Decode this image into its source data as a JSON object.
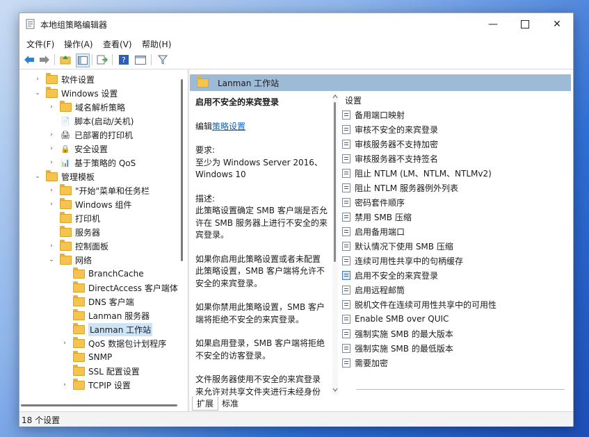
{
  "window": {
    "title": "本地组策略编辑器"
  },
  "menu": [
    "文件(F)",
    "操作(A)",
    "查看(V)",
    "帮助(H)"
  ],
  "tree": [
    {
      "label": "软件设置",
      "depth": 1,
      "arrow": "›",
      "icon": "folder"
    },
    {
      "label": "Windows 设置",
      "depth": 1,
      "arrow": "⌄",
      "icon": "folder"
    },
    {
      "label": "域名解析策略",
      "depth": 2,
      "arrow": "›",
      "icon": "folder"
    },
    {
      "label": "脚本(启动/关机)",
      "depth": 2,
      "arrow": "",
      "icon": "script-icon"
    },
    {
      "label": "已部署的打印机",
      "depth": 2,
      "arrow": "›",
      "icon": "printer-icon"
    },
    {
      "label": "安全设置",
      "depth": 2,
      "arrow": "›",
      "icon": "security-icon"
    },
    {
      "label": "基于策略的 QoS",
      "depth": 2,
      "arrow": "›",
      "icon": "chart-icon"
    },
    {
      "label": "管理模板",
      "depth": 1,
      "arrow": "⌄",
      "icon": "folder"
    },
    {
      "label": "\"开始\"菜单和任务栏",
      "depth": 2,
      "arrow": "›",
      "icon": "folder"
    },
    {
      "label": "Windows 组件",
      "depth": 2,
      "arrow": "›",
      "icon": "folder"
    },
    {
      "label": "打印机",
      "depth": 2,
      "arrow": "",
      "icon": "folder"
    },
    {
      "label": "服务器",
      "depth": 2,
      "arrow": "",
      "icon": "folder"
    },
    {
      "label": "控制面板",
      "depth": 2,
      "arrow": "›",
      "icon": "folder"
    },
    {
      "label": "网络",
      "depth": 2,
      "arrow": "⌄",
      "icon": "folder"
    },
    {
      "label": "BranchCache",
      "depth": 3,
      "arrow": "",
      "icon": "folder"
    },
    {
      "label": "DirectAccess 客户端体",
      "depth": 3,
      "arrow": "",
      "icon": "folder"
    },
    {
      "label": "DNS 客户端",
      "depth": 3,
      "arrow": "",
      "icon": "folder"
    },
    {
      "label": "Lanman 服务器",
      "depth": 3,
      "arrow": "",
      "icon": "folder"
    },
    {
      "label": "Lanman 工作站",
      "depth": 3,
      "arrow": "",
      "icon": "folder",
      "selected": true
    },
    {
      "label": "QoS 数据包计划程序",
      "depth": 3,
      "arrow": "›",
      "icon": "folder"
    },
    {
      "label": "SNMP",
      "depth": 3,
      "arrow": "",
      "icon": "folder"
    },
    {
      "label": "SSL 配置设置",
      "depth": 3,
      "arrow": "",
      "icon": "folder"
    },
    {
      "label": "TCPIP 设置",
      "depth": 3,
      "arrow": "›",
      "icon": "folder"
    }
  ],
  "header": {
    "title": "Lanman 工作站"
  },
  "description": {
    "title": "启用不安全的来宾登录",
    "edit_prefix": "编辑",
    "edit_link": "策略设置",
    "requirements": "要求:\n至少为 Windows Server 2016、Windows 10",
    "desc_label": "描述:",
    "p1": "此策略设置确定 SMB 客户端是否允许在 SMB 服务器上进行不安全的来宾登录。",
    "p2": "如果你启用此策略设置或者未配置此策略设置，SMB 客户端将允许不安全的来宾登录。",
    "p3": "如果你禁用此策略设置，SMB 客户端将拒绝不安全的来宾登录。",
    "p4": "如果启用登录，SMB 客户端将拒绝不安全的访客登录。",
    "p5": "文件服务器使用不安全的来宾登录来允许对共享文件夹进行未经身份"
  },
  "settings": {
    "header": "设置",
    "items": [
      "备用端口映射",
      "审核不安全的来宾登录",
      "审核服务器不支持加密",
      "审核服务器不支持签名",
      "阻止 NTLM (LM、NTLM、NTLMv2)",
      "阻止 NTLM 服务器例外列表",
      "密码套件顺序",
      "禁用 SMB 压缩",
      "启用备用端口",
      "默认情况下使用 SMB 压缩",
      "连续可用性共享中的句柄缓存",
      "启用不安全的来宾登录",
      "启用远程邮筒",
      "脱机文件在连续可用性共享中的可用性",
      "Enable SMB over QUIC",
      "强制实施 SMB 的最大版本",
      "强制实施 SMB 的最低版本",
      "需要加密"
    ],
    "active_index": 11
  },
  "tabs": [
    "扩展",
    "标准"
  ],
  "status": "18 个设置"
}
